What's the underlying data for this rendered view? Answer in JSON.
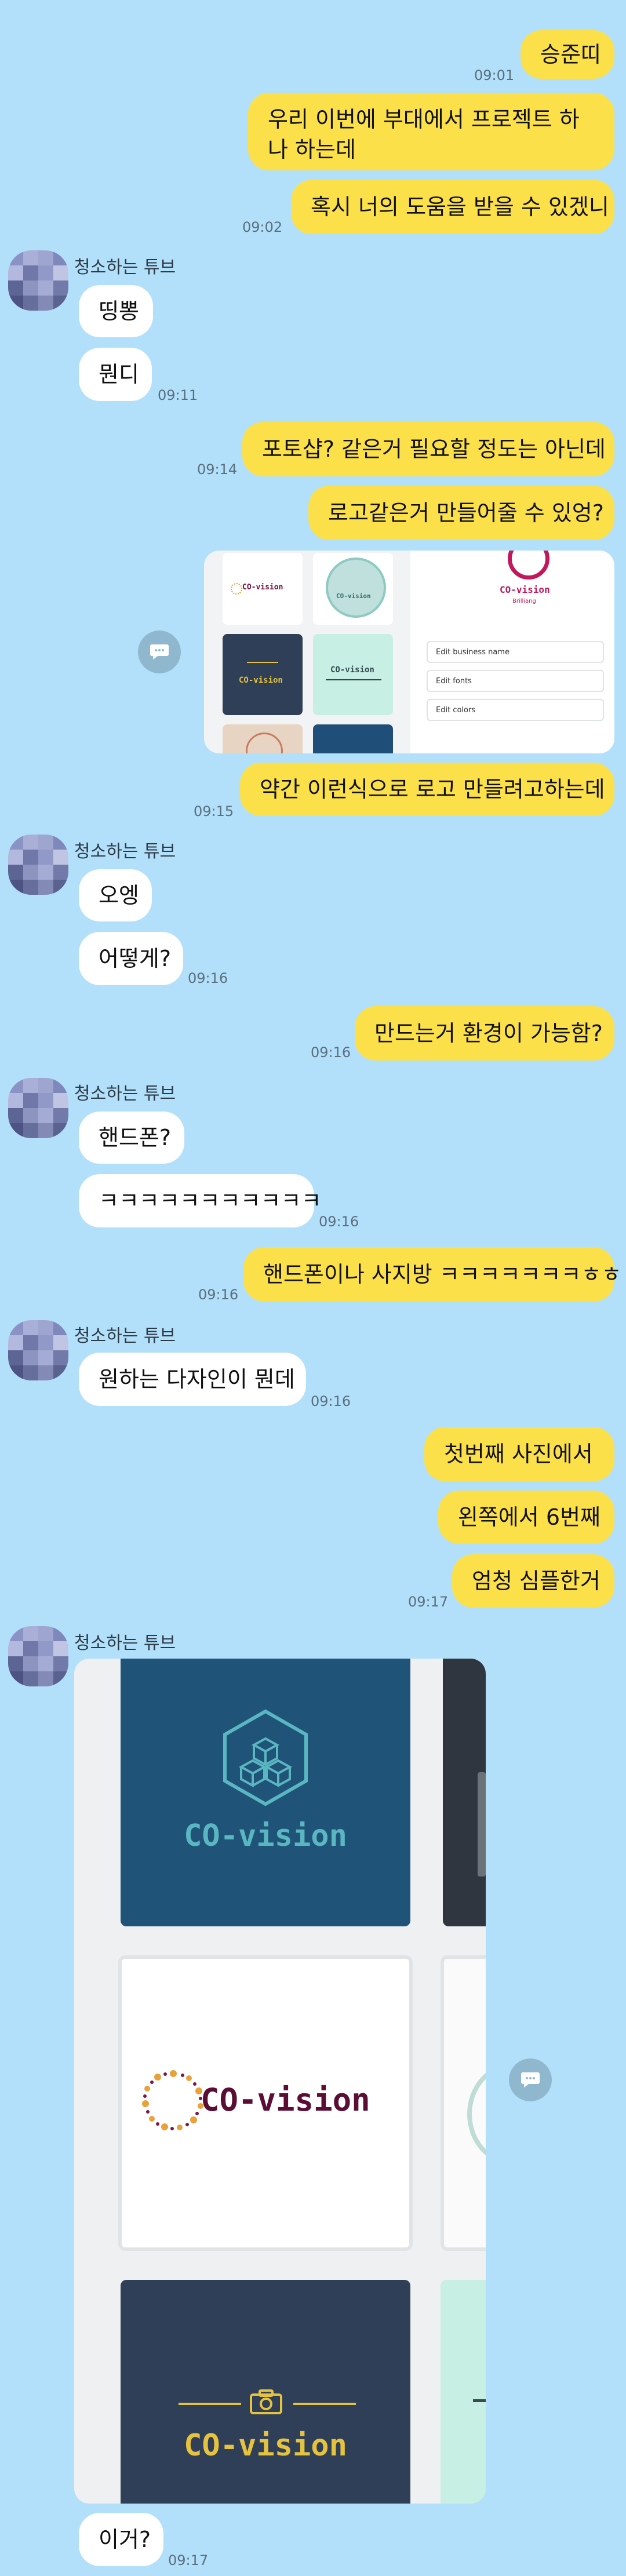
{
  "contact": {
    "name": "청소하는 튜브"
  },
  "messages": [
    {
      "id": "m1",
      "from": "me",
      "text": "승준띠"
    },
    {
      "id": "m2",
      "from": "me",
      "text": "우리 이번에 부대에서 프로젝트 하나 하는데",
      "time": "09:01"
    },
    {
      "id": "m3",
      "from": "me",
      "text": "혹시 너의 도움을 받을 수 있겠니",
      "time": "09:02"
    },
    {
      "id": "m4",
      "from": "other",
      "text": "띵뽕"
    },
    {
      "id": "m5",
      "from": "other",
      "text": "뭔디",
      "time": "09:11"
    },
    {
      "id": "m6",
      "from": "me",
      "text": "포토샵? 같은거 필요할 정도는 아닌데",
      "time": "09:14"
    },
    {
      "id": "m7",
      "from": "me",
      "text": "로고같은거 만들어줄 수 있엉?"
    },
    {
      "id": "m8",
      "from": "me",
      "text": "약간 이런식으로 로고 만들려고하는데",
      "time": "09:15"
    },
    {
      "id": "m9",
      "from": "other",
      "text": "오엥"
    },
    {
      "id": "m10",
      "from": "other",
      "text": "어떻게?",
      "time": "09:16"
    },
    {
      "id": "m11",
      "from": "me",
      "text": "만드는거 환경이 가능함?",
      "time": "09:16"
    },
    {
      "id": "m12",
      "from": "other",
      "text": "핸드폰?"
    },
    {
      "id": "m13",
      "from": "other",
      "text": "ㅋㅋㅋㅋㅋㅋㅋㅋㅋㅋㅋ",
      "time": "09:16"
    },
    {
      "id": "m14",
      "from": "me",
      "text": "핸드폰이나 사지방 ㅋㅋㅋㅋㅋㅋㅋㅎㅎ",
      "time": "09:16"
    },
    {
      "id": "m15",
      "from": "other",
      "text": "원하는 다자인이 뭔데",
      "time": "09:16"
    },
    {
      "id": "m16",
      "from": "me",
      "text": "첫번째 사진에서"
    },
    {
      "id": "m17",
      "from": "me",
      "text": "왼쪽에서 6번째"
    },
    {
      "id": "m18",
      "from": "me",
      "text": "엄청 심플한거",
      "time": "09:17"
    },
    {
      "id": "m19",
      "from": "other",
      "text": "이거?",
      "time": "09:17"
    }
  ],
  "sent_image": {
    "logo_text": "CO-vision",
    "sub_text": "Brilliang",
    "edit_options": [
      "Edit business name",
      "Edit fonts",
      "Edit colors"
    ]
  },
  "received_image": {
    "logo_text": "CO-vision"
  },
  "colors": {
    "background": "#b2e0fb",
    "my_bubble": "#fbe04a",
    "their_bubble": "#ffffff",
    "time": "#5a6e7c"
  },
  "icons": {
    "avatar": "pixelated-avatar",
    "share": "share-bubble-icon"
  }
}
